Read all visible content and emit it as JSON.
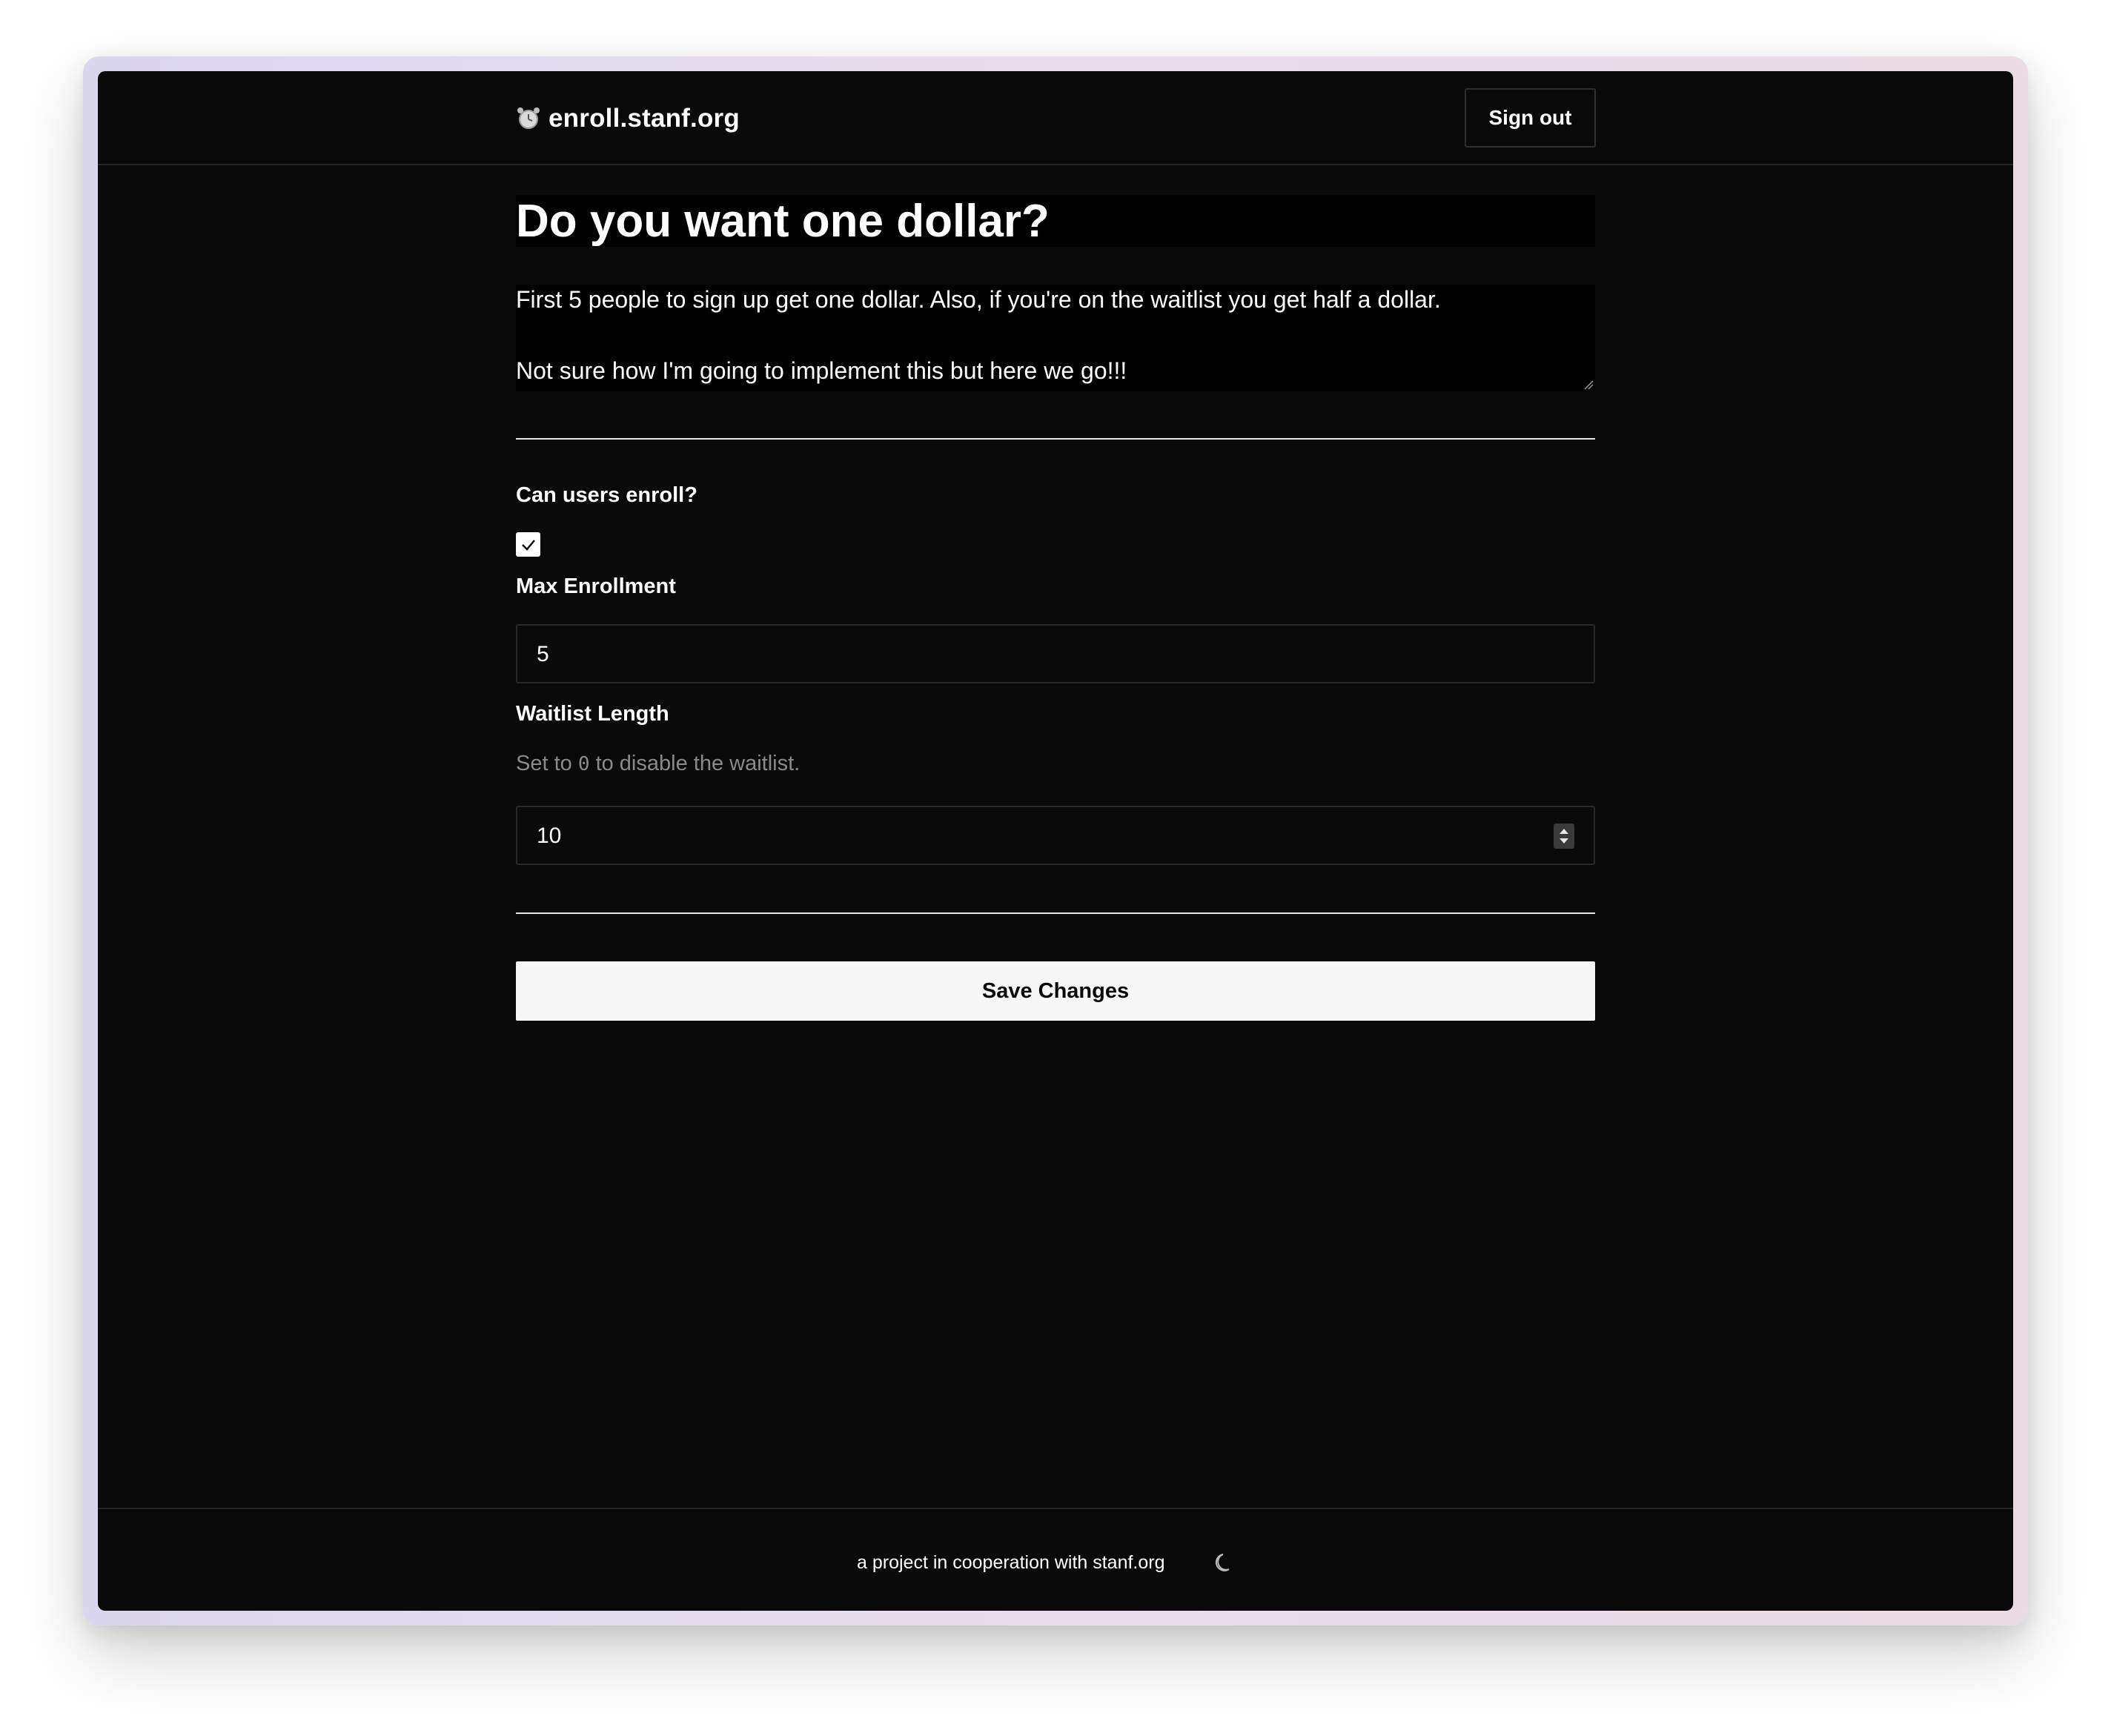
{
  "header": {
    "brand_icon": "alarm-clock-icon",
    "brand": "enroll.stanf.org",
    "signout_label": "Sign out"
  },
  "form": {
    "title": "Do you want one dollar?",
    "description_lines": [
      "First 5 people to sign up get one dollar. Also, if you're on the waitlist you get half a dollar.",
      "Not sure how I'm going to implement this but here we go!!!"
    ],
    "enroll_label": "Can users enroll?",
    "enroll_checked": true,
    "max_label": "Max Enrollment",
    "max_value": "5",
    "waitlist_label": "Waitlist Length",
    "waitlist_hint_prefix": "Set to",
    "waitlist_hint_code": "0",
    "waitlist_hint_suffix": "to disable the waitlist.",
    "waitlist_value": "10",
    "save_label": "Save Changes"
  },
  "footer": {
    "text": "a project in cooperation with stanf.org",
    "theme_icon": "moon-icon"
  },
  "colors": {
    "background": "#0a0a0a",
    "field_background": "#000000",
    "text": "#ffffff",
    "muted": "#8a8a8a",
    "button_bg": "#f7f7f7"
  }
}
